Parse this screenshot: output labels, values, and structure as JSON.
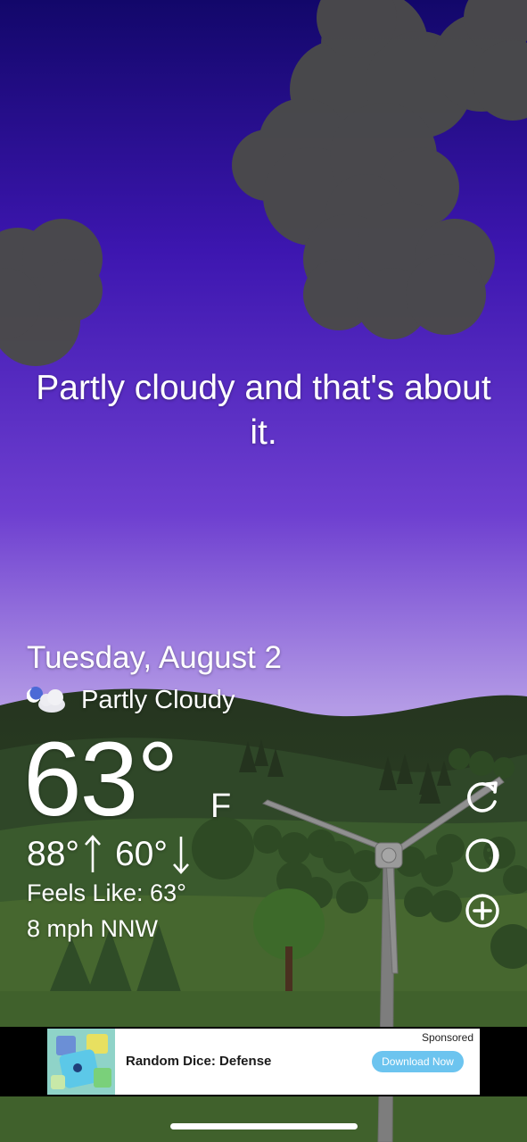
{
  "tagline": "Partly cloudy and that's about it.",
  "weather": {
    "date": "Tuesday, August 2",
    "condition": "Partly Cloudy",
    "condition_icon": "partly-cloudy-night-icon",
    "temperature": "63°",
    "unit": "F",
    "high": "88°",
    "low": "60°",
    "feels_like": "Feels Like: 63°",
    "wind": "8 mph NNW"
  },
  "actions": {
    "refresh_icon": "refresh-icon",
    "moon_icon": "moon-phase-icon",
    "add_icon": "add-location-icon"
  },
  "ad": {
    "sponsored": "Sponsored",
    "title": "Random Dice: Defense",
    "cta": "Download Now"
  },
  "colors": {
    "sky_top": "#1a0f6e",
    "sky_bottom": "#b49be6",
    "hills": "#3b5a2f",
    "ad_button": "#6cc4ef"
  }
}
